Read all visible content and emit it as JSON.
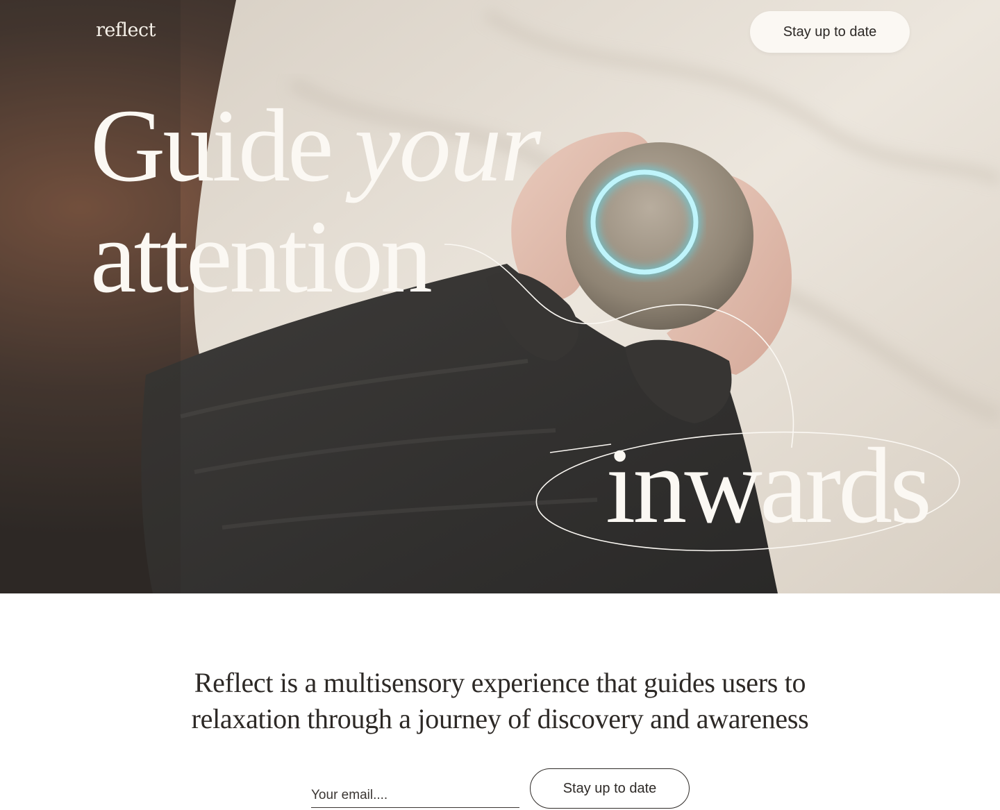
{
  "header": {
    "logo": "reflect",
    "cta_label": "Stay up to date"
  },
  "hero": {
    "headline_word_1": "Guide",
    "headline_word_2": "your",
    "headline_word_3": "attention",
    "headline_word_4": "inwards",
    "image": "hands-holding-glowing-orb"
  },
  "intro": {
    "description": "Reflect is a multisensory experience that guides users to relaxation through a journey of discovery and awareness"
  },
  "signup": {
    "email_placeholder": "Your email....",
    "cta_label": "Stay up to date"
  },
  "colors": {
    "cream": "#fbf8f3",
    "ink": "#2d2926",
    "glow": "#5fd6e8"
  }
}
